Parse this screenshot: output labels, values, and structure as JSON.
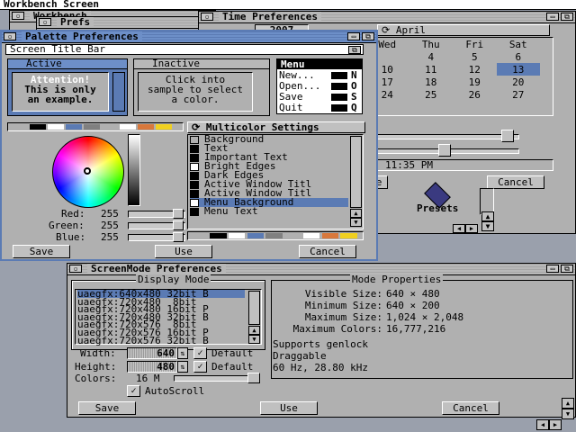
{
  "screen_title": "Workbench Screen",
  "wb_window_title": "Workbench",
  "prefs_window_title": "Prefs",
  "time": {
    "title": "Time Preferences",
    "year": "2007",
    "month": "April",
    "weekdays": [
      "Wed",
      "Thu",
      "Fri",
      "Sat"
    ],
    "days": [
      [
        "",
        "4",
        "5",
        "6"
      ],
      [
        "10",
        "11",
        "12",
        "13"
      ],
      [
        "17",
        "18",
        "19",
        "20"
      ],
      [
        "24",
        "25",
        "26",
        "27"
      ]
    ],
    "selected_day": "13",
    "clock": "11:35 PM",
    "cancel": "Cancel",
    "save_partial": "e"
  },
  "presets_label": "Presets",
  "palette": {
    "title": "Palette Preferences",
    "screen_title_bar": "Screen Title Bar",
    "active_label": "Active",
    "inactive_label": "Inactive",
    "active_text": [
      "Attention!",
      "This is only",
      "an example."
    ],
    "inactive_text": [
      "Click into",
      "sample to select",
      "a color."
    ],
    "menu": {
      "title": "Menu",
      "items": [
        {
          "label": "New...",
          "key": "N"
        },
        {
          "label": "Open...",
          "key": "O"
        },
        {
          "label": "Save",
          "key": "S"
        },
        {
          "label": "Quit",
          "key": "Q"
        }
      ]
    },
    "multicolor_label": "Multicolor Settings",
    "items": [
      "Background",
      "Text",
      "Important Text",
      "Bright Edges",
      "Dark Edges",
      "Active Window Titl",
      "Active Window Titl",
      "Menu Background",
      "Menu Text"
    ],
    "item_colors": [
      "#b0b0b0",
      "#000000",
      "#000000",
      "#ffffff",
      "#000000",
      "#000000",
      "#000000",
      "#ffffff",
      "#000000"
    ],
    "selected_index": 7,
    "red_label": "Red:",
    "red": "255",
    "green_label": "Green:",
    "green": "255",
    "blue_label": "Blue:",
    "blue": "255",
    "swatches": [
      "#000000",
      "#ffffff",
      "#5b7bb4",
      "#808080",
      "#b0b0b0",
      "#ffffff",
      "#d8783c",
      "#f0d020"
    ],
    "save": "Save",
    "use": "Use",
    "cancel": "Cancel"
  },
  "screenmode": {
    "title": "ScreenMode Preferences",
    "display_mode_label": "Display Mode",
    "mode_properties_label": "Mode Properties",
    "modes": [
      "uaegfx:640x480 32bit B",
      "uaegfx:720x480  8bit",
      "uaegfx:720x480 16bit P",
      "uaegfx:720x480 32bit B",
      "uaegfx:720x576  8bit",
      "uaegfx:720x576 16bit P",
      "uaegfx:720x576 32bit B"
    ],
    "selected_mode": 0,
    "props": [
      {
        "label": "Visible Size:",
        "value": "640 × 480"
      },
      {
        "label": "Minimum Size:",
        "value": "640 × 200"
      },
      {
        "label": "Maximum Size:",
        "value": "1,024 × 2,048"
      },
      {
        "label": "Maximum Colors:",
        "value": "16,777,216"
      }
    ],
    "features": [
      "Supports genlock",
      "Draggable",
      "60 Hz, 28.80 kHz"
    ],
    "width_label": "Width:",
    "width": "640",
    "height_label": "Height:",
    "height": "480",
    "colors_label": "Colors:",
    "colors": "16 M",
    "default_label": "Default",
    "autoscroll": "AutoScroll",
    "save": "Save",
    "use": "Use",
    "cancel": "Cancel"
  }
}
